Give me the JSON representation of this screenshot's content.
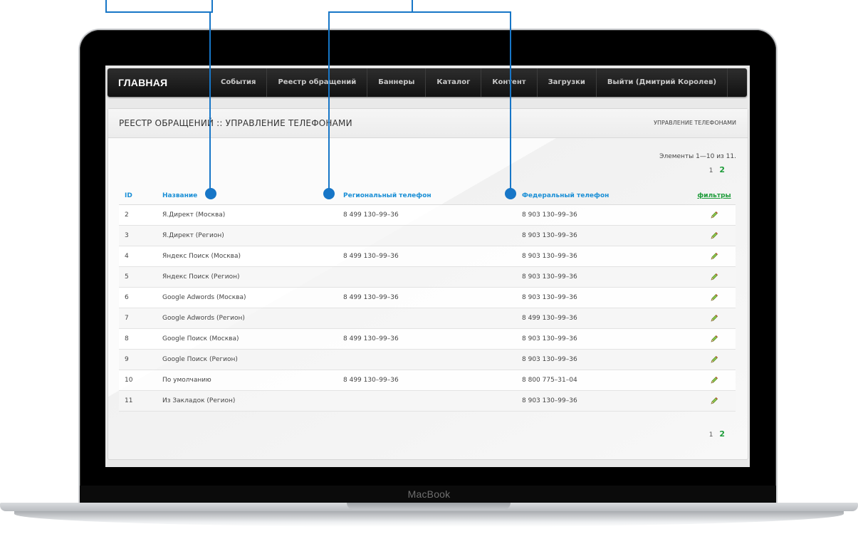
{
  "device": {
    "brand": "MacBook"
  },
  "nav": {
    "home": "ГЛАВНАЯ",
    "items": [
      {
        "label": "События"
      },
      {
        "label": "Реестр обращений"
      },
      {
        "label": "Баннеры"
      },
      {
        "label": "Каталог"
      },
      {
        "label": "Контент"
      },
      {
        "label": "Загрузки"
      },
      {
        "label": "Выйти (Дмитрий Королев)"
      }
    ]
  },
  "panel": {
    "title": "РЕЕСТР ОБРАЩЕНИЙ :: УПРАВЛЕНИЕ ТЕЛЕФОНАМИ",
    "breadcrumb": "УПРАВЛЕНИЕ ТЕЛЕФОНАМИ",
    "items_info": "Элементы 1—10 из 11.",
    "pagination": {
      "current": "1",
      "next": "2"
    }
  },
  "table": {
    "headers": {
      "id": "ID",
      "name": "Название",
      "regional": "Региональный телефон",
      "federal": "Федеральный телефон",
      "filters": "фильтры"
    },
    "rows": [
      {
        "id": "2",
        "name": "Я.Директ (Москва)",
        "regional": "8 499 130–99–36",
        "federal": "8 903 130–99–36"
      },
      {
        "id": "3",
        "name": "Я.Директ (Регион)",
        "regional": "",
        "federal": "8 903 130–99–36"
      },
      {
        "id": "4",
        "name": "Яндекс Поиск (Москва)",
        "regional": "8 499 130–99–36",
        "federal": "8 903 130–99–36"
      },
      {
        "id": "5",
        "name": "Яндекс Поиск (Регион)",
        "regional": "",
        "federal": "8 903 130–99–36"
      },
      {
        "id": "6",
        "name": "Google Adwords (Москва)",
        "regional": "8 499 130–99–36",
        "federal": "8 903 130–99–36"
      },
      {
        "id": "7",
        "name": "Google Adwords (Регион)",
        "regional": "",
        "federal": "8 499 130–99–36"
      },
      {
        "id": "8",
        "name": "Google Поиск (Москва)",
        "regional": "8 499 130–99–36",
        "federal": "8 903 130–99–36"
      },
      {
        "id": "9",
        "name": "Google Поиск (Регион)",
        "regional": "",
        "federal": "8 903 130–99–36"
      },
      {
        "id": "10",
        "name": "По умолчанию",
        "regional": "8 499 130–99–36",
        "federal": "8 800 775–31–04"
      },
      {
        "id": "11",
        "name": "Из Закладок (Регион)",
        "regional": "",
        "federal": "8 903 130–99–36"
      }
    ]
  },
  "icons": {
    "edit": "pencil-icon"
  },
  "colors": {
    "accent": "#1a8fd6",
    "link_green": "#1e9c3a",
    "callout": "#1776c7",
    "nav_bg": "#1a1a1a"
  }
}
